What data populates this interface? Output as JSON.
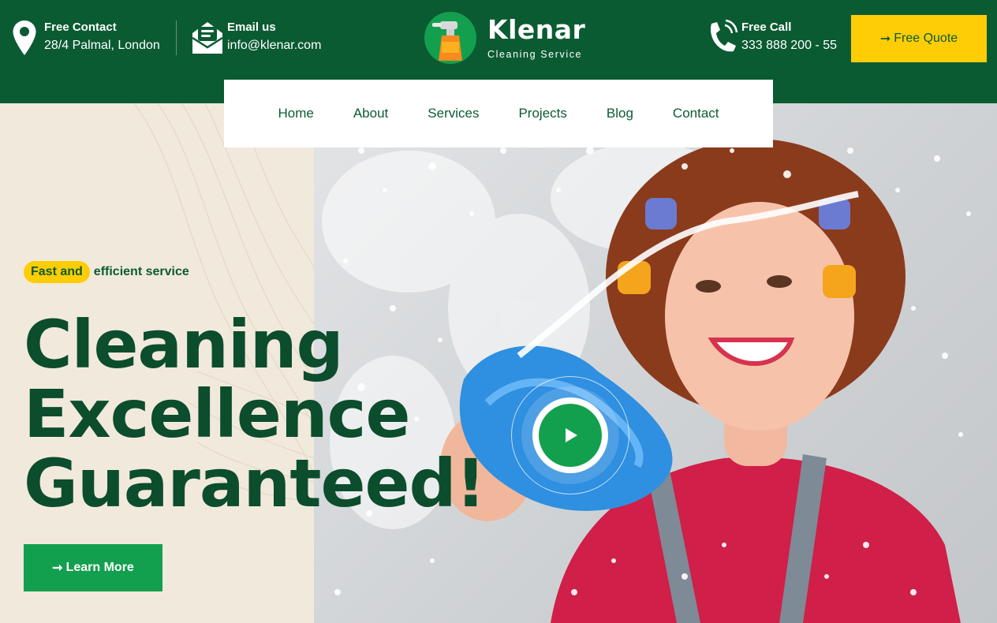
{
  "header": {
    "contact": {
      "label": "Free Contact",
      "value": "28/4 Palmal, London",
      "icon": "map-pin-icon"
    },
    "email": {
      "label": "Email us",
      "value": "info@klenar.com",
      "icon": "envelope-icon"
    },
    "call": {
      "label": "Free Call",
      "value": "333 888 200 - 55",
      "icon": "phone-icon"
    },
    "logo": {
      "name": "Klenar",
      "subtitle": "Cleaning Service",
      "icon": "spray-bottle-icon"
    },
    "quote_button": {
      "arrow": "➞",
      "label": "Free Quote"
    }
  },
  "nav": {
    "items": [
      {
        "label": "Home"
      },
      {
        "label": "About"
      },
      {
        "label": "Services"
      },
      {
        "label": "Projects"
      },
      {
        "label": "Blog"
      },
      {
        "label": "Contact"
      }
    ]
  },
  "hero": {
    "tag_highlight": "Fast and",
    "tag_rest": "efficient service",
    "headline": [
      "Cleaning",
      "Excellence",
      "Guaranteed!"
    ],
    "learn_button": {
      "arrow": "➞",
      "label": "Learn More"
    },
    "play_icon": "play-icon"
  },
  "colors": {
    "brand_green": "#0b5b32",
    "accent_green": "#13a04e",
    "accent_yellow": "#ffcd06",
    "headline_green": "#0b4d2c",
    "cream": "#f1e9dc"
  }
}
